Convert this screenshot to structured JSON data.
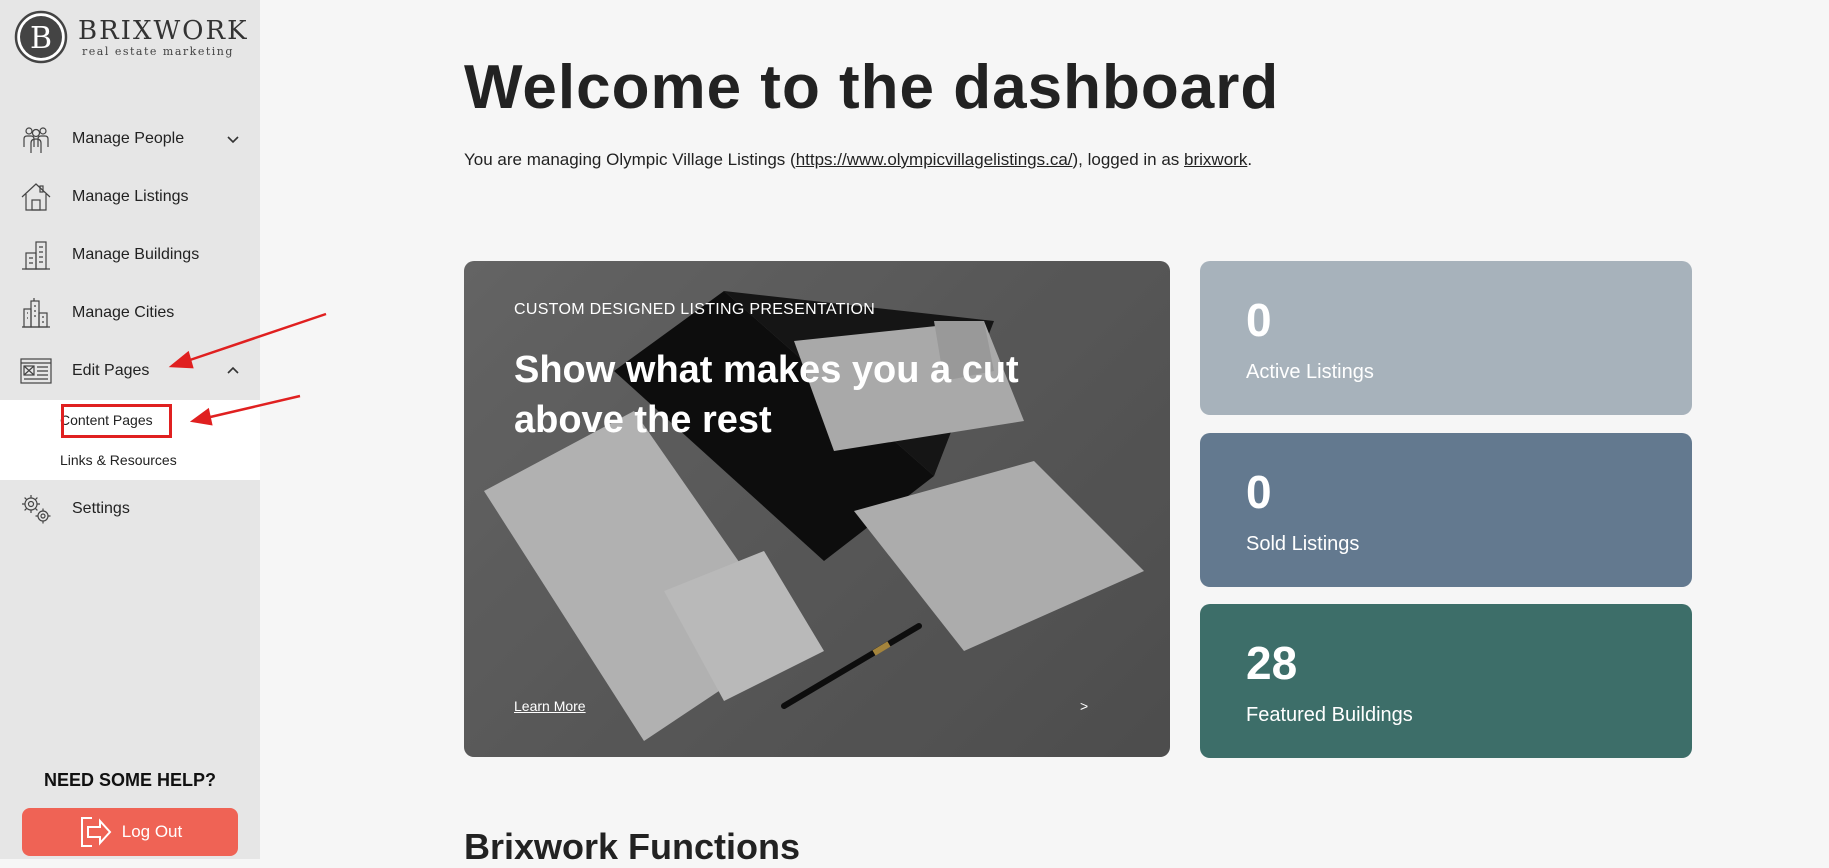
{
  "brand": {
    "name": "BRIXWORK",
    "tagline": "real estate marketing",
    "letter": "B"
  },
  "sidebar": {
    "items": [
      {
        "label": "Manage People",
        "icon": "people-icon",
        "chevron": "down"
      },
      {
        "label": "Manage Listings",
        "icon": "house-icon"
      },
      {
        "label": "Manage Buildings",
        "icon": "building-icon"
      },
      {
        "label": "Manage Cities",
        "icon": "city-icon"
      },
      {
        "label": "Edit Pages",
        "icon": "page-edit-icon",
        "chevron": "up"
      },
      {
        "label": "Settings",
        "icon": "gears-icon"
      }
    ],
    "subitems": [
      {
        "label": "Content Pages",
        "highlighted": true
      },
      {
        "label": "Links & Resources"
      }
    ],
    "help_title": "NEED SOME HELP?",
    "logout_label": "Log Out"
  },
  "main": {
    "title": "Welcome to the dashboard",
    "intro": {
      "prefix": "You are managing Olympic Village Listings (",
      "url": "https://www.olympicvillagelistings.ca/",
      "middle": "), logged in as ",
      "user": "brixwork",
      "suffix": "."
    },
    "promo": {
      "eyebrow": "CUSTOM DESIGNED LISTING PRESENTATION",
      "heading": "Show what makes you a cut above the rest",
      "link": "Learn More",
      "link_arrow": ">"
    },
    "stats": [
      {
        "value": "0",
        "label": "Active Listings",
        "color": "#a7b2bb"
      },
      {
        "value": "0",
        "label": "Sold Listings",
        "color": "#63798f"
      },
      {
        "value": "28",
        "label": "Featured Buildings",
        "color": "#3d6e69"
      }
    ],
    "section_title": "Brixwork Functions"
  },
  "colors": {
    "sidebar_bg": "#e6e6e6",
    "logout_bg": "#ef6355",
    "annotation_red": "#e02020"
  }
}
